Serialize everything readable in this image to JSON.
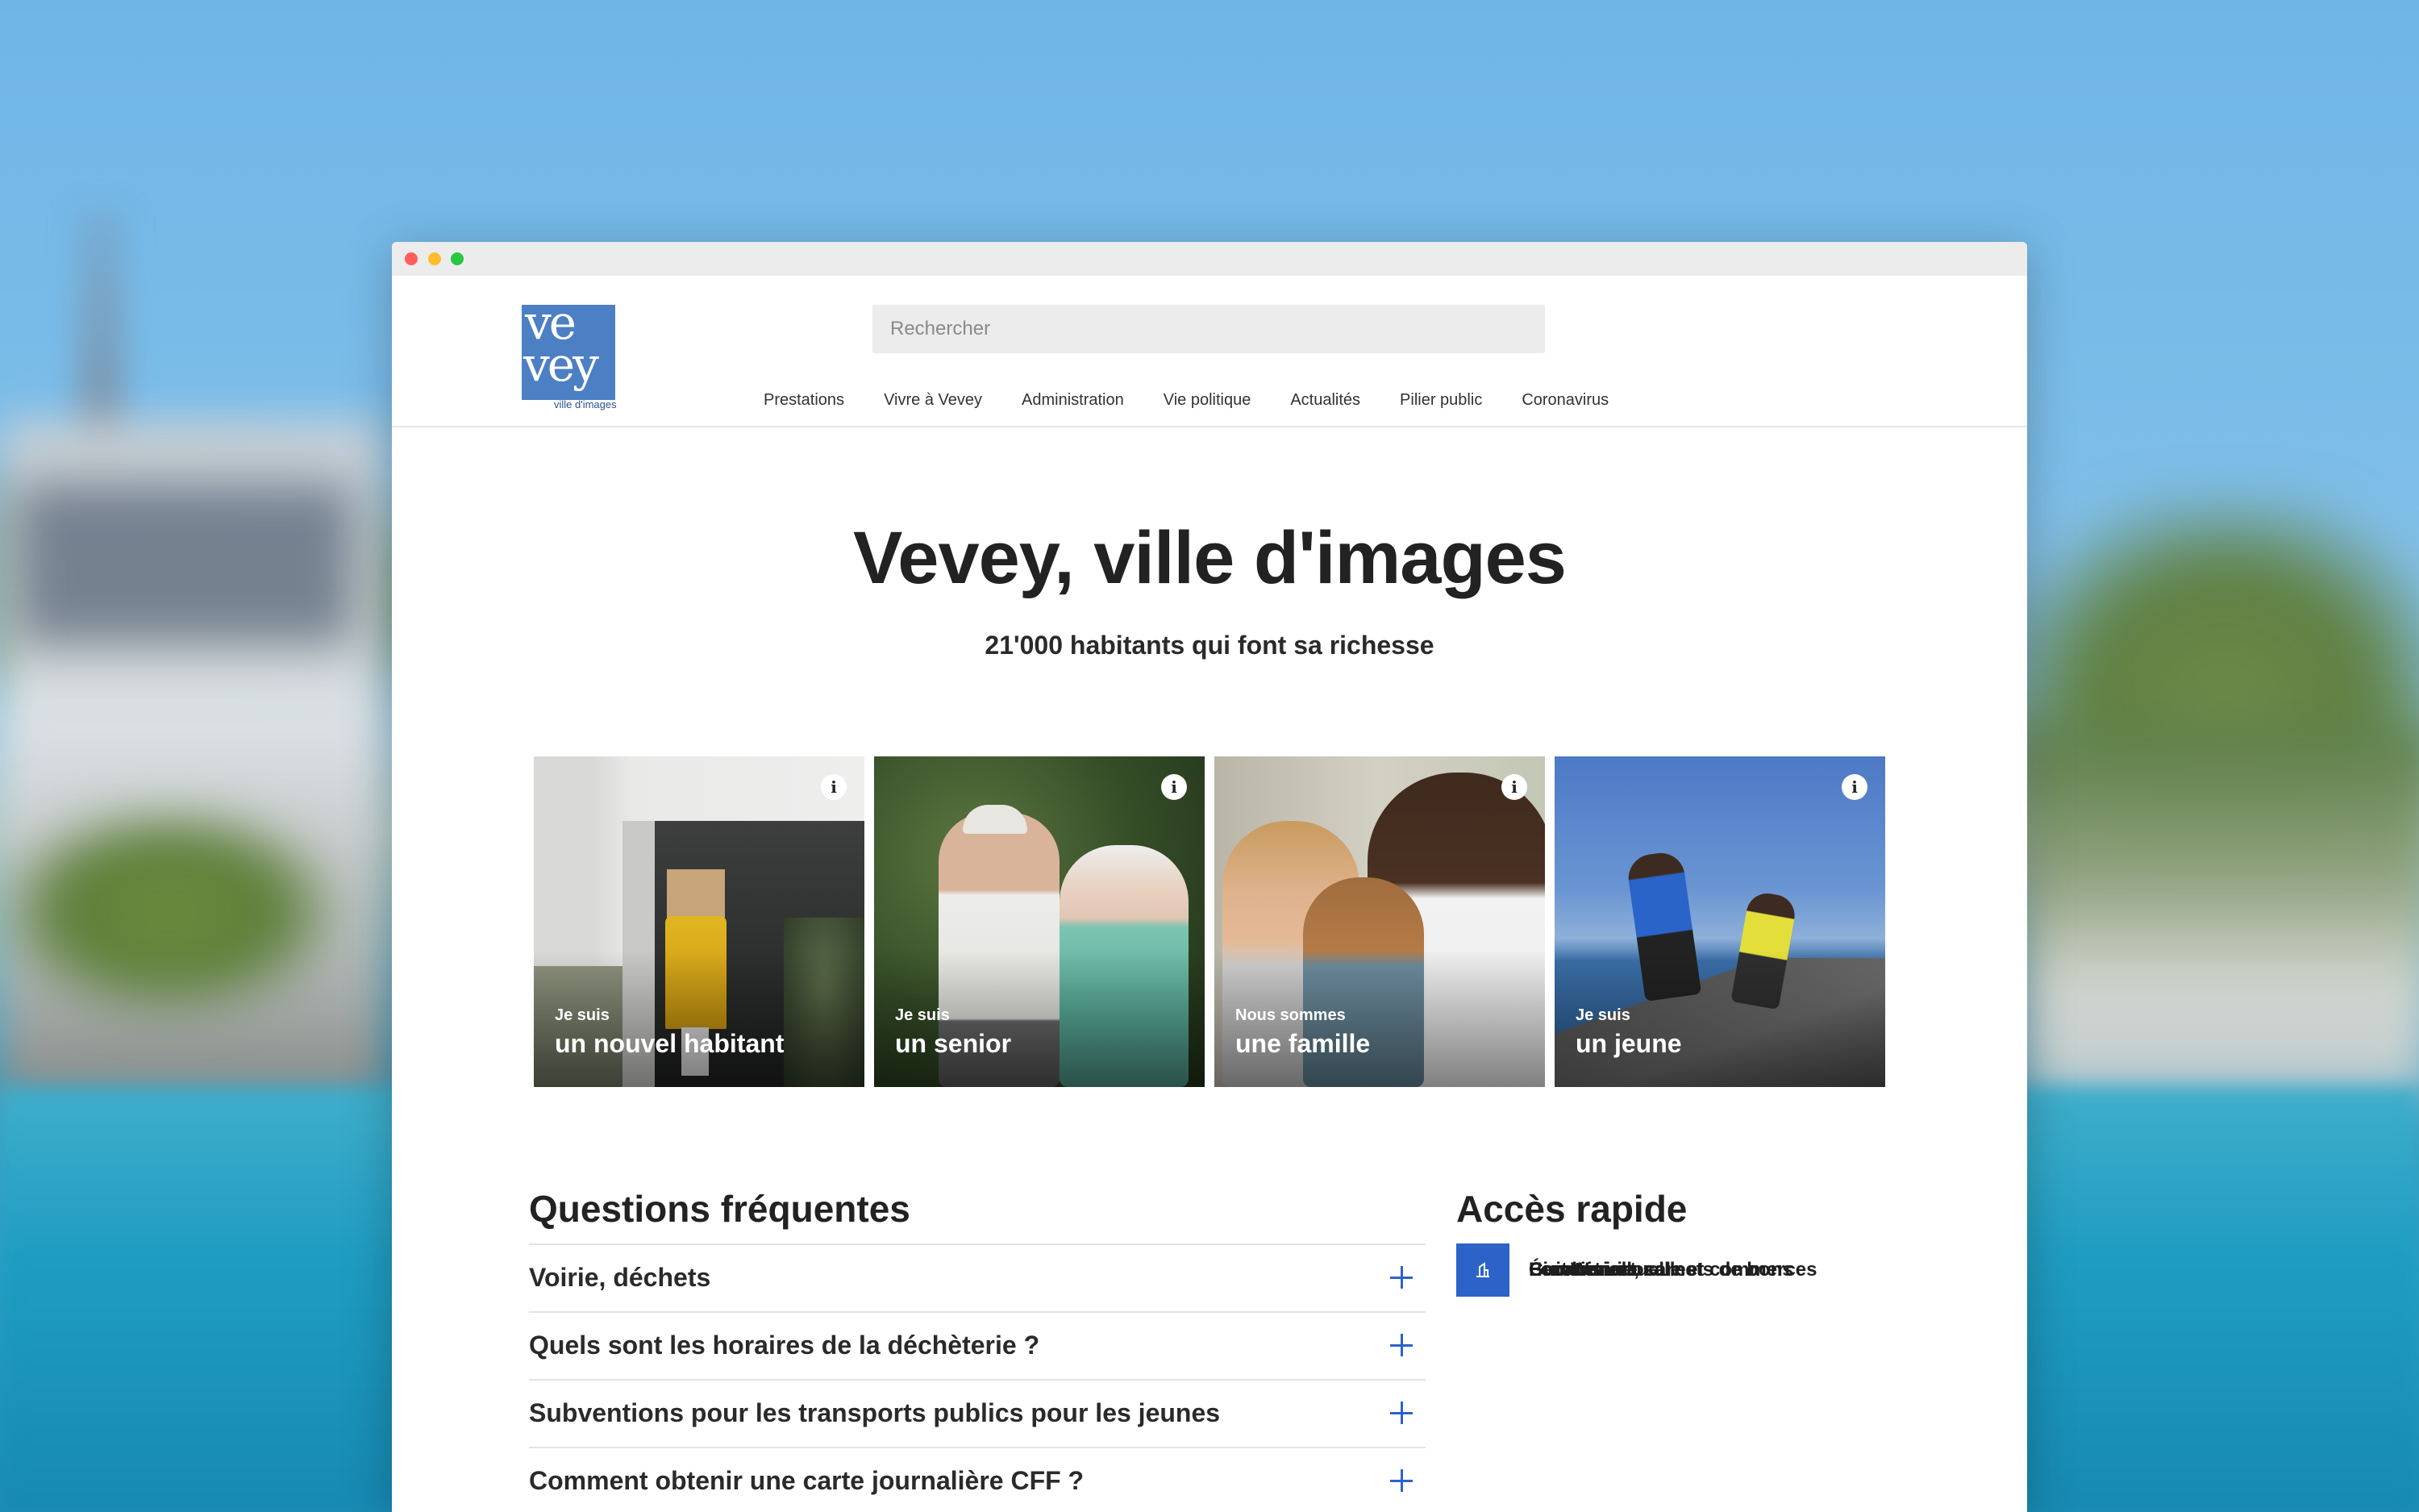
{
  "header": {
    "logo": {
      "line1": "ve",
      "line2": "vey",
      "tagline": "ville d'images"
    },
    "search": {
      "placeholder": "Rechercher"
    },
    "nav": [
      "Prestations",
      "Vivre à Vevey",
      "Administration",
      "Vie politique",
      "Actualités",
      "Pilier public",
      "Coronavirus"
    ]
  },
  "hero": {
    "title": "Vevey, ville d'images",
    "subtitle": "21'000 habitants qui font sa richesse"
  },
  "cards": [
    {
      "pre": "Je suis",
      "main": "un nouvel habitant",
      "info": "i"
    },
    {
      "pre": "Je suis",
      "main": "un senior",
      "info": "i"
    },
    {
      "pre": "Nous sommes",
      "main": "une famille",
      "info": "i"
    },
    {
      "pre": "Je suis",
      "main": "un jeune",
      "info": "i"
    }
  ],
  "faq": {
    "title": "Questions fréquentes",
    "items": [
      "Voirie, déchets",
      "Quels sont les horaires de la déchèterie ?",
      "Subventions pour les transports publics pour les jeunes",
      "Comment obtenir une carte journalière CFF ?"
    ]
  },
  "quick_access": {
    "title": "Accès rapide",
    "items": [
      {
        "label": "Guichet virtuel",
        "icon": "people-icon"
      },
      {
        "label": "Économie locale et commerces",
        "icon": "shop-icon"
      },
      {
        "label": "BienWenue, carnets de bons",
        "icon": "shop-icon"
      },
      {
        "label": "Cartoriviera",
        "icon": "map-icon"
      },
      {
        "label": "Location de salles",
        "icon": "room-icon"
      }
    ]
  },
  "colors": {
    "accent": "#2d62c9",
    "accent_light": "#e5eefb",
    "logo": "#4d7fc4"
  }
}
